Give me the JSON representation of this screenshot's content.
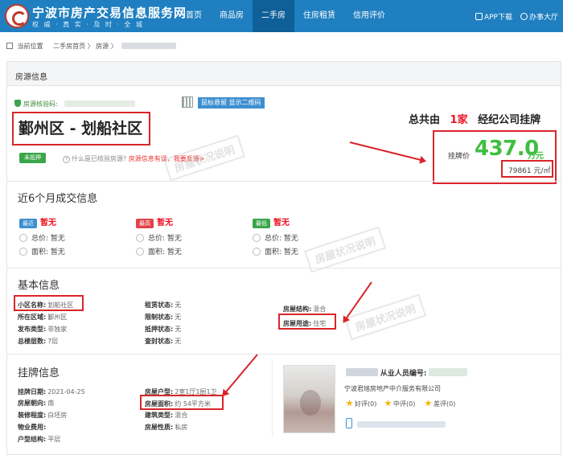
{
  "header": {
    "site_title": "宁波市房产交易信息服务网",
    "slogan": "权 威 · 真 实 · 及 时 · 全 城",
    "nav": [
      "首页",
      "商品房",
      "二手房",
      "住房租赁",
      "信用评价"
    ],
    "active_nav": "二手房",
    "app_download": "APP下载",
    "office": "办事大厅"
  },
  "breadcrumb": {
    "label": "当前位置",
    "path": "二手房首页 〉 房源 〉"
  },
  "panel_title": "房源信息",
  "listing": {
    "verify_label": "房源核验码:",
    "qr_button": "鼠标悬留 显示二维码",
    "community_title": "鄞州区 - 划船社区",
    "mortgage_tag": "未抵押",
    "verify_question": "什么是已核验房源?",
    "verify_false": "房源信息有误，我要反馈>",
    "agency_prefix": "总共由",
    "agency_count": "1家",
    "agency_suffix": "经纪公司挂牌",
    "price_label": "挂牌价",
    "price": "437.0",
    "price_unit": "万元",
    "unit_price": "79861 元/㎡"
  },
  "recent_deals": {
    "title": "近6个月成交信息",
    "items": [
      {
        "badge": "最近",
        "badge_color": "#3d8fd0",
        "value": "暂无",
        "total": "总价: 暂无",
        "area": "面积: 暂无"
      },
      {
        "badge": "最高",
        "badge_color": "#e2434b",
        "value": "暂无",
        "total": "总价: 暂无",
        "area": "面积: 暂无"
      },
      {
        "badge": "最低",
        "badge_color": "#3aa64a",
        "value": "暂无",
        "total": "总价: 暂无",
        "area": "面积: 暂无"
      }
    ]
  },
  "basic_info": {
    "title": "基本信息",
    "col1": [
      {
        "k": "小区名称:",
        "v": "划船社区"
      },
      {
        "k": "所在区域:",
        "v": "鄞州区"
      },
      {
        "k": "发布类型:",
        "v": "非独家"
      },
      {
        "k": "总楼层数:",
        "v": "7层"
      }
    ],
    "col2": [
      {
        "k": "租赁状态:",
        "v": "无"
      },
      {
        "k": "限制状态:",
        "v": "无"
      },
      {
        "k": "抵押状态:",
        "v": "无"
      },
      {
        "k": "查封状态:",
        "v": "无"
      }
    ],
    "col3": [
      {
        "k": "房屋结构:",
        "v": "混合"
      },
      {
        "k": "房屋用途:",
        "v": "住宅"
      }
    ]
  },
  "listing_info": {
    "title": "挂牌信息",
    "col1": [
      {
        "k": "挂牌日期:",
        "v": "2021-04-25"
      },
      {
        "k": "房屋朝向:",
        "v": "南"
      },
      {
        "k": "装修程度:",
        "v": "白坯房"
      },
      {
        "k": "物业费用:",
        "v": ""
      },
      {
        "k": "户型结构:",
        "v": "平层"
      }
    ],
    "col2": [
      {
        "k": "房屋户型:",
        "v": "2室1厅1厨1卫"
      },
      {
        "k": "房屋面积:",
        "v": "约 54平方米"
      },
      {
        "k": "建筑类型:",
        "v": "混合"
      },
      {
        "k": "房屋性质:",
        "v": "私房"
      }
    ]
  },
  "agent": {
    "id_label": "从业人员编号:",
    "company": "宁波君旭房地产中介服务有限公司",
    "ratings": [
      {
        "label": "好评(0)",
        "color": "#f5b400"
      },
      {
        "label": "中评(0)",
        "color": "#f5b400"
      },
      {
        "label": "差评(0)",
        "color": "#f5b400"
      }
    ]
  },
  "watermark": "房屋状况说明"
}
